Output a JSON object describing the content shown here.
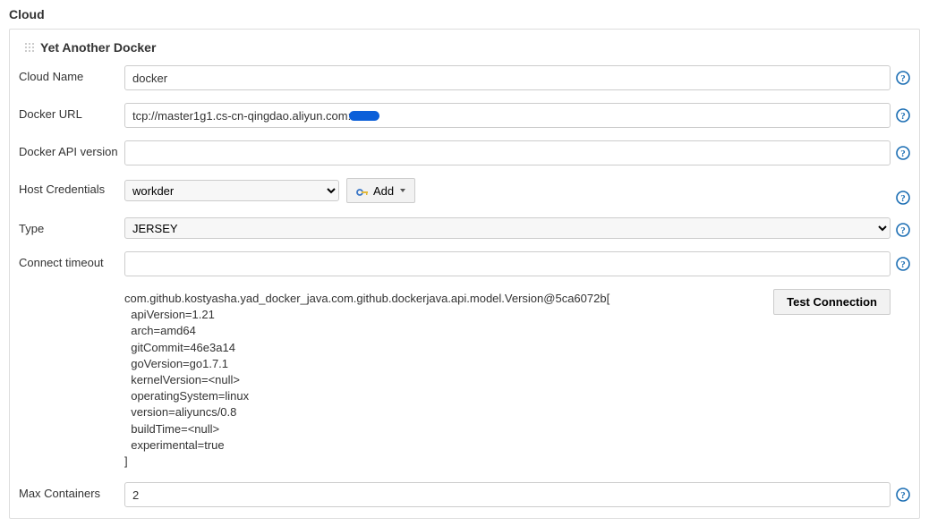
{
  "section": {
    "title": "Cloud",
    "subtitle": "Yet Another Docker"
  },
  "labels": {
    "cloud_name": "Cloud Name",
    "docker_url": "Docker URL",
    "docker_api_version": "Docker API version",
    "host_credentials": "Host Credentials",
    "type": "Type",
    "connect_timeout": "Connect timeout",
    "max_containers": "Max Containers",
    "add_button": "Add",
    "test_button": "Test Connection"
  },
  "values": {
    "cloud_name": "docker",
    "docker_url_prefix": "tcp://master1g1.cs-cn-qingdao.aliyun.com:",
    "docker_api_version": "",
    "host_credentials_selected": "workder",
    "type_selected": "JERSEY",
    "connect_timeout": "",
    "max_containers": "2"
  },
  "status_output": "com.github.kostyasha.yad_docker_java.com.github.dockerjava.api.model.Version@5ca6072b[\n  apiVersion=1.21\n  arch=amd64\n  gitCommit=46e3a14\n  goVersion=go1.7.1\n  kernelVersion=<null>\n  operatingSystem=linux\n  version=aliyuncs/0.8\n  buildTime=<null>\n  experimental=true\n]"
}
